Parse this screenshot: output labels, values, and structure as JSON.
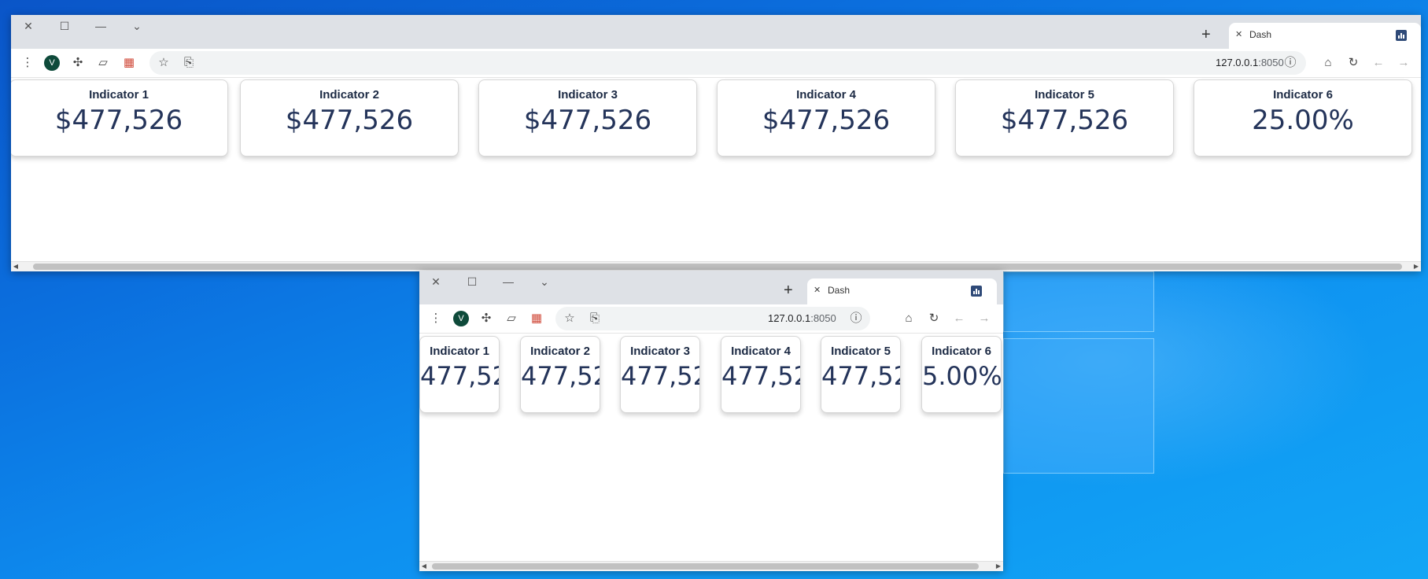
{
  "browser": {
    "tab_title": "Dash",
    "avatar_letter": "V",
    "url_host": "127.0.0.1",
    "url_port": ":8050"
  },
  "window_top": {
    "indicators": [
      {
        "label": "Indicator 1",
        "value": "$477,526"
      },
      {
        "label": "Indicator 2",
        "value": "$477,526"
      },
      {
        "label": "Indicator 3",
        "value": "$477,526"
      },
      {
        "label": "Indicator 4",
        "value": "$477,526"
      },
      {
        "label": "Indicator 5",
        "value": "$477,526"
      },
      {
        "label": "Indicator 6",
        "value": "25.00%"
      }
    ]
  },
  "window_bottom": {
    "indicators": [
      {
        "label": "Indicator 1",
        "value": "477,52"
      },
      {
        "label": "Indicator 2",
        "value": "477,52"
      },
      {
        "label": "Indicator 3",
        "value": "477,52"
      },
      {
        "label": "Indicator 4",
        "value": "477,52"
      },
      {
        "label": "Indicator 5",
        "value": "477,52"
      },
      {
        "label": "Indicator 6",
        "value": "5.00%"
      }
    ]
  },
  "icons": {
    "close": "close-icon",
    "maximize": "maximize-icon",
    "minimize": "minimize-icon",
    "tab_search": "chevron-down-icon",
    "menu": "kebab-menu-icon",
    "extensions": "puzzle-icon",
    "reading": "reading-list-icon",
    "app": "app-grid-icon",
    "bookmark": "star-icon",
    "share": "share-icon",
    "info": "info-icon",
    "home": "home-icon",
    "reload": "reload-icon",
    "back": "arrow-left-icon",
    "forward": "arrow-right-icon"
  },
  "colors": {
    "value_text": "#24345a",
    "label_text": "#1c2a44",
    "titlebar": "#dee1e6",
    "avatar": "#0e4a3a"
  }
}
